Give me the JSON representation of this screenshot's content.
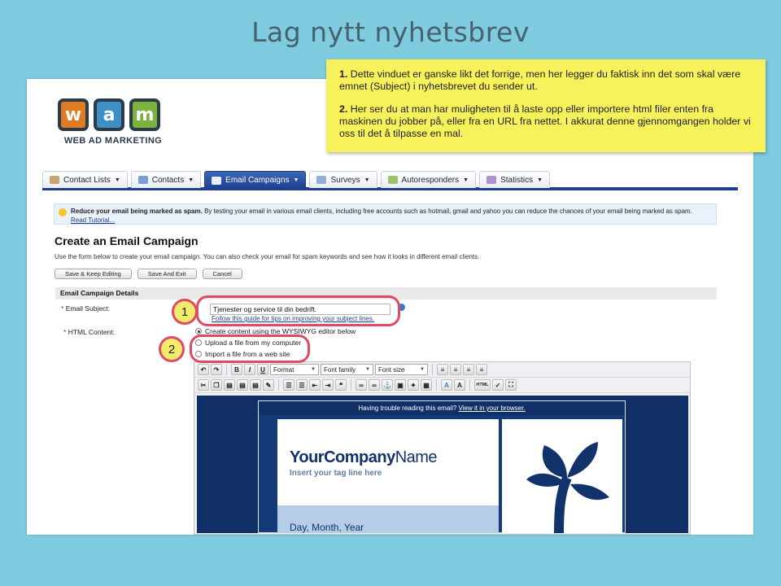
{
  "slide": {
    "title": "Lag nytt nyhetsbrev"
  },
  "note": {
    "p1_num": "1.",
    "p1_text": " Dette vinduet er ganske likt det forrige, men her legger du faktisk inn det som skal være emnet (Subject) i nyhetsbrevet du sender ut.",
    "p2_num": "2.",
    "p2_text": " Her ser du at man har muligheten til å laste opp eller importere html filer enten fra maskinen du jobber på, eller fra en URL fra nettet. I akkurat denne gjennomgangen holder vi oss til det å tilpasse en mal."
  },
  "logo": {
    "letters": [
      "w",
      "a",
      "m"
    ],
    "text": "WEB AD MARKETING"
  },
  "nav": {
    "tabs": [
      {
        "label": "Contact Lists",
        "icon": "contact-lists-icon"
      },
      {
        "label": "Contacts",
        "icon": "contacts-icon"
      },
      {
        "label": "Email Campaigns",
        "icon": "email-campaigns-icon",
        "active": true
      },
      {
        "label": "Surveys",
        "icon": "surveys-icon"
      },
      {
        "label": "Autoresponders",
        "icon": "autoresponders-icon"
      },
      {
        "label": "Statistics",
        "icon": "statistics-icon"
      }
    ]
  },
  "notice": {
    "bold": "Reduce your email being marked as spam.",
    "text": " By testing your email in various email clients, including free accounts such as hotmail, gmail and yahoo you can reduce the chances of your email being marked as spam.",
    "link": "Read Tutorial..."
  },
  "page": {
    "title": "Create an Email Campaign",
    "subtitle": "Use the form below to create your email campaign. You can also check your email for spam keywords and see how it looks in different email clients."
  },
  "buttons": {
    "save_keep": "Save & Keep Editing",
    "save_exit": "Save And Exit",
    "cancel": "Cancel"
  },
  "details": {
    "header": "Email Campaign Details",
    "subject_label": "Email Subject:",
    "subject_value": "Tjenester og service til din bedrift.",
    "subject_hint": "Follow this guide for tips on improving your subject lines.",
    "html_label": "HTML Content:",
    "options": [
      {
        "label": "Create content using the WYSIWYG editor below",
        "selected": true
      },
      {
        "label": "Upload a file from my computer",
        "selected": false
      },
      {
        "label": "Import a file from a web site",
        "selected": false
      }
    ]
  },
  "callouts": {
    "one": "1",
    "two": "2"
  },
  "editor": {
    "format": "Format",
    "font_family": "Font family",
    "font_size": "Font size",
    "bold": "B",
    "italic": "I",
    "underline": "U",
    "html": "HTML"
  },
  "preview": {
    "trouble": "Having trouble reading this email?",
    "view_link": "View it in your browser.",
    "brand_bold": "YourCompany",
    "brand_rest": "Name",
    "tagline": "Insert your tag line here",
    "date": "Day, Month, Year"
  },
  "colors": {
    "nav_active": "#1e3f8e",
    "callout": "#e04a63",
    "note": "#f7f15b",
    "background": "#7fcbe0"
  }
}
